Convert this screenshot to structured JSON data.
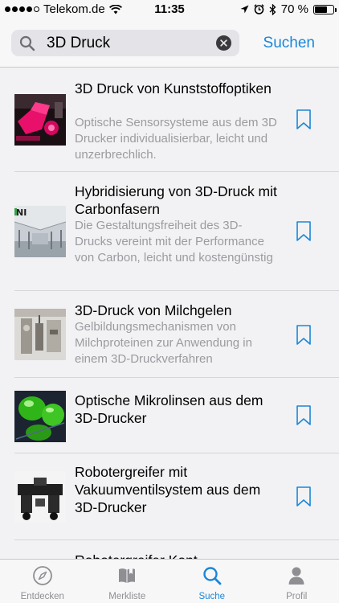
{
  "status_bar": {
    "carrier": "Telekom.de",
    "time": "11:35",
    "battery": "70 %",
    "battery_level": 0.7
  },
  "search": {
    "query": "3D Druck",
    "cancel_label": "Suchen"
  },
  "results": [
    {
      "title": "3D Druck von Kunststoffoptiken",
      "description": "Optische Sensorsysteme aus dem 3D Drucker individualisierbar, leicht und unzerbrechlich.",
      "thumb": "pink-optics"
    },
    {
      "title": "Hybridisierung von 3D-Druck mit Carbonfasern",
      "description": "Die Gestaltungsfreiheit des 3D-Drucks vereint mit der Performance von Carbon, leicht und kostengünstig",
      "thumb": "hall"
    },
    {
      "title": "3D-Druck von Milchgelen",
      "description": "Gelbildungsmechanismen von Milchproteinen zur Anwendung in einem 3D-Druckverfahren",
      "thumb": "lab"
    },
    {
      "title": "Optische Mikrolinsen aus dem 3D-Drucker",
      "description": "",
      "thumb": "green-lenses"
    },
    {
      "title": "Robotergreifer mit Vakuumventilsystem aus dem 3D-Drucker",
      "description": "",
      "thumb": "gripper"
    },
    {
      "title": "Roboter... (partially hidden)",
      "description": "",
      "thumb": ""
    }
  ],
  "tabs": [
    {
      "label": "Entdecken",
      "icon": "compass-icon",
      "active": false
    },
    {
      "label": "Merkliste",
      "icon": "book-icon",
      "active": false
    },
    {
      "label": "Suche",
      "icon": "search-icon",
      "active": true
    },
    {
      "label": "Profil",
      "icon": "person-icon",
      "active": false
    }
  ],
  "colors": {
    "accent": "#1a87d8",
    "secondary_text": "#9b9ba0",
    "background": "#f2f2f4"
  }
}
